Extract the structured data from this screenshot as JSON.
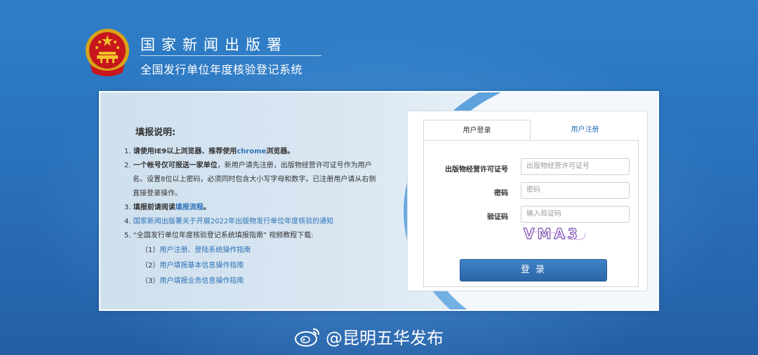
{
  "header": {
    "title": "国家新闻出版署",
    "subtitle": "全国发行单位年度核验登记系统"
  },
  "instructions": {
    "title": "填报说明:",
    "item1_prefix": "1. ",
    "item1_text": "请使用IE9以上浏览器、推荐使用",
    "item1_link": "chrome",
    "item1_suffix": "浏览器。",
    "item2_prefix": "2. ",
    "item2_bold": "一个帐号仅可报送一家单位",
    "item2_text": "，新用户请先注册，出版物经营许可证号作为用户",
    "item2_line2": "名。设置8位以上密码，必须同时包含大小写字母和数字。已注册用户请从右侧",
    "item2_line3": "直接登录操作。",
    "item3_prefix": "3. ",
    "item3_text": "填报前请阅读",
    "item3_link": "填报流程",
    "item3_suffix": "。",
    "item4_prefix": "4. ",
    "item4_link": "国家新闻出版署关于开展2022年出版物发行单位年度核验的通知",
    "item5": "5. “全国发行单位年度核验登记系统填报指南” 视频教程下载:",
    "guides": [
      {
        "num": "（1）",
        "label": "用户注册、登陆系统操作指南"
      },
      {
        "num": "（2）",
        "label": "用户填报基本信息操作指南"
      },
      {
        "num": "（3）",
        "label": "用户填报业务信息操作指南"
      }
    ]
  },
  "login": {
    "tab_login": "用户登录",
    "tab_register": "用户注册",
    "license_label": "出版物经营许可证号",
    "license_placeholder": "出版物经营许可证号",
    "password_label": "密码",
    "password_placeholder": "密码",
    "captcha_label": "验证码",
    "captcha_placeholder": "输入验证码",
    "captcha_text": "VMA3",
    "submit_label": "登 录"
  },
  "watermark": {
    "text": "@昆明五华发布"
  }
}
